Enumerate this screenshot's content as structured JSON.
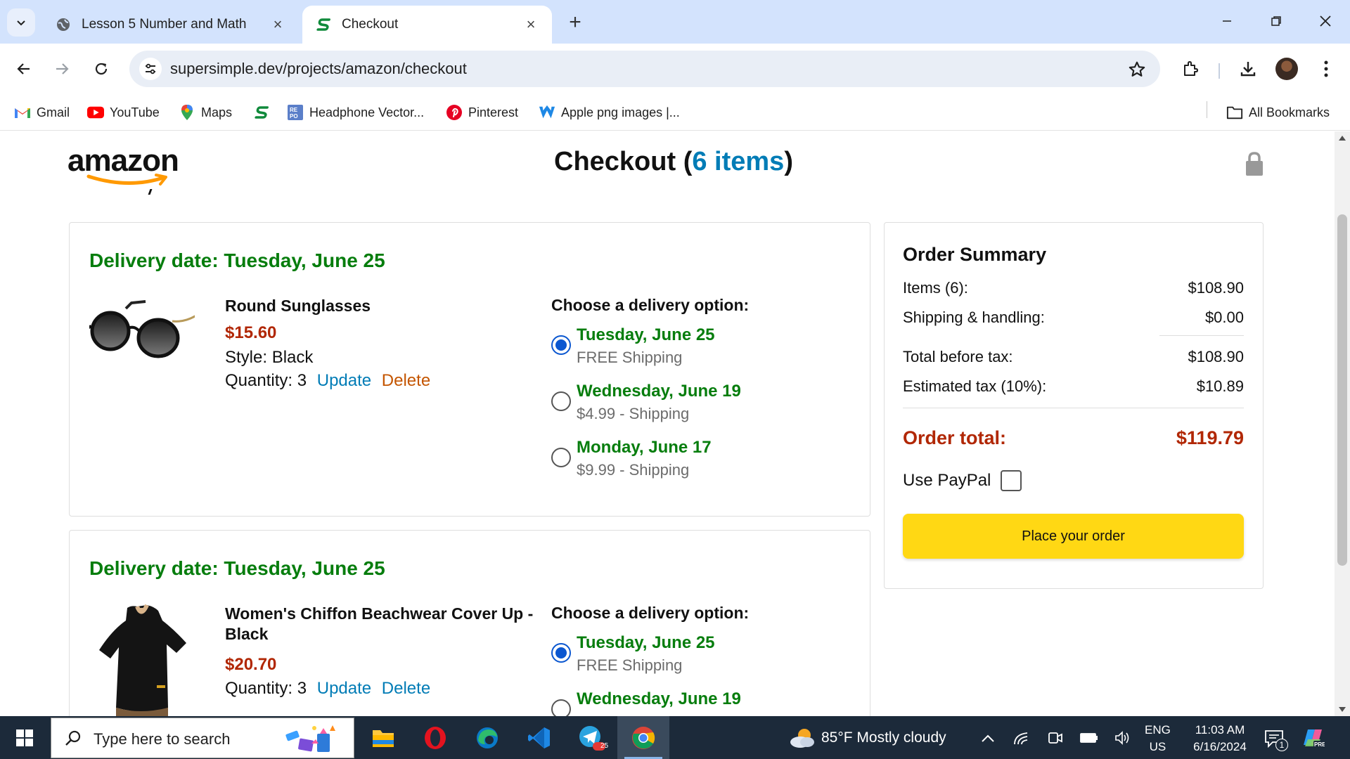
{
  "browser": {
    "tabs": [
      {
        "label": "Lesson 5 Number and Math",
        "icon": "globe-icon"
      },
      {
        "label": "Checkout",
        "icon": "supersimple-icon",
        "active": true
      }
    ],
    "url": "supersimple.dev/projects/amazon/checkout",
    "bookmarks": [
      {
        "label": "Gmail",
        "icon": "gmail-icon"
      },
      {
        "label": "YouTube",
        "icon": "youtube-icon"
      },
      {
        "label": "Maps",
        "icon": "maps-icon"
      },
      {
        "label": "",
        "icon": "supersimple-icon"
      },
      {
        "label": "Headphone Vector...",
        "icon": "repo-icon"
      },
      {
        "label": "Pinterest",
        "icon": "pinterest-icon"
      },
      {
        "label": "Apple png images |...",
        "icon": "w-icon"
      }
    ],
    "all_bookmarks": "All Bookmarks"
  },
  "header": {
    "logo_text": "amazon",
    "title_prefix": "Checkout (",
    "items_count": "6 items",
    "title_suffix": ")"
  },
  "cart": [
    {
      "delivery_date": "Delivery date: Tuesday, June 25",
      "name": "Round Sunglasses",
      "price": "$15.60",
      "style": "Style: Black",
      "quantity": "Quantity: 3",
      "update": "Update",
      "delete": "Delete",
      "options_title": "Choose a delivery option:",
      "options": [
        {
          "date": "Tuesday, June 25",
          "shipping": "FREE Shipping",
          "checked": true
        },
        {
          "date": "Wednesday, June 19",
          "shipping": "$4.99 - Shipping",
          "checked": false
        },
        {
          "date": "Monday, June 17",
          "shipping": "$9.99 - Shipping",
          "checked": false
        }
      ]
    },
    {
      "delivery_date": "Delivery date: Tuesday, June 25",
      "name": "Women's Chiffon Beachwear Cover Up - Black",
      "price": "$20.70",
      "quantity": "Quantity: 3",
      "update": "Update",
      "delete": "Delete",
      "options_title": "Choose a delivery option:",
      "options": [
        {
          "date": "Tuesday, June 25",
          "shipping": "FREE Shipping",
          "checked": true
        },
        {
          "date": "Wednesday, June 19",
          "shipping": "",
          "checked": false
        }
      ]
    }
  ],
  "summary": {
    "title": "Order Summary",
    "rows": [
      {
        "label": "Items (6):",
        "value": "$108.90"
      },
      {
        "label": "Shipping & handling:",
        "value": "$0.00"
      },
      {
        "label": "Total before tax:",
        "value": "$108.90"
      },
      {
        "label": "Estimated tax (10%):",
        "value": "$10.89"
      }
    ],
    "total_label": "Order total:",
    "total_value": "$119.79",
    "paypal_label": "Use PayPal",
    "place_order": "Place your order"
  },
  "taskbar": {
    "search_placeholder": "Type here to search",
    "weather": "85°F  Mostly cloudy",
    "lang_top": "ENG",
    "lang_bottom": "US",
    "time": "11:03 AM",
    "date": "6/16/2024",
    "notification_count": "1",
    "telegram_badge": "25"
  },
  "colors": {
    "green": "#067d0d",
    "price_red": "#b12704",
    "link_blue": "#017cb6",
    "delete_orange": "#c45500",
    "button_yellow": "#ffd814",
    "taskbar_bg": "#1c2a3a"
  }
}
